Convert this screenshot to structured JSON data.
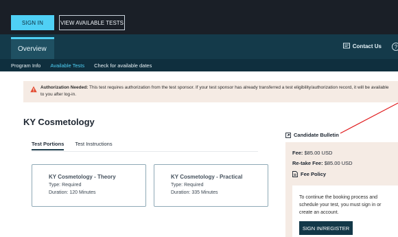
{
  "header": {
    "sign_in_label": "SIGN IN",
    "view_tests_label": "VIEW AVAILABLE TESTS",
    "overview_tab": "Overview",
    "contact_label": "Contact Us",
    "help_glyph": "?"
  },
  "subnav": {
    "items": [
      "Program Info",
      "Available Tests",
      "Check for available dates"
    ],
    "active_index": 1
  },
  "alert": {
    "title": "Authorization Needed:",
    "message": "This test requires authorization from the test sponsor. If your test sponsor has already transferred a test eligibility/authorization record, it will be available to you after log-in."
  },
  "page": {
    "title": "KY Cosmetology",
    "tabs": [
      "Test Portions",
      "Test Instructions"
    ]
  },
  "cards": [
    {
      "name": "KY Cosmetology - Theory",
      "type": "Type: Required",
      "duration": "Duration: 120 Minutes"
    },
    {
      "name": "KY Cosmetology - Practical",
      "type": "Type: Required",
      "duration": "Duration: 335 Minutes"
    }
  ],
  "sidebar": {
    "bulletin_label": "Candidate Bulletin",
    "fee_label": "Fee:",
    "fee_value": "$85.00 USD",
    "retake_label": "Re-take Fee:",
    "retake_value": "$85.00 USD",
    "policy_label": "Fee Policy",
    "signin_message": "To continue the booking process and schedule your test, you must sign in or create an account.",
    "register_label": "SIGN IN/REGISTER"
  },
  "colors": {
    "accent": "#4fd0f5",
    "dark_nav": "#143a4a",
    "alert_bg": "#f5ebe4",
    "alert_icon": "#e2492f",
    "annotation_line": "#e0191b"
  },
  "icons": {
    "contact": "message-icon",
    "help": "question-circle-icon",
    "warning": "warning-triangle-icon",
    "bulletin": "external-link-icon",
    "policy": "document-icon"
  }
}
